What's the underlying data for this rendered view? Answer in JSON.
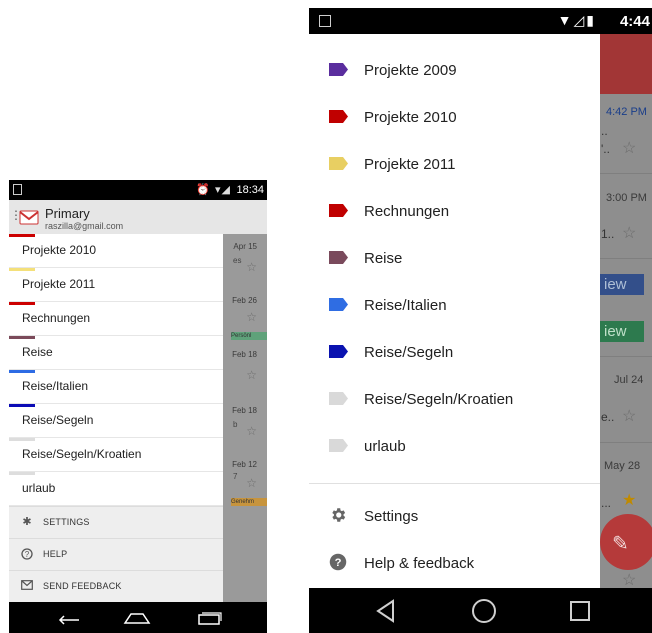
{
  "left_phone": {
    "status_bar": {
      "time": "18:34",
      "icons": "⏰ ▾◢"
    },
    "account": {
      "name": "Primary",
      "email": "raszilla@gmail.com"
    },
    "labels": [
      {
        "name": "Projekte 2010",
        "color": "#cc0000"
      },
      {
        "name": "Projekte 2011",
        "color": "#f4e07a"
      },
      {
        "name": "Rechnungen",
        "color": "#cc0000"
      },
      {
        "name": "Reise",
        "color": "#7b4a5a"
      },
      {
        "name": "Reise/Italien",
        "color": "#2d6be4"
      },
      {
        "name": "Reise/Segeln",
        "color": "#0b0bb5"
      },
      {
        "name": "Reise/Segeln/Kroatien",
        "color": "#dddddd"
      },
      {
        "name": "urlaub",
        "color": "#dddddd"
      }
    ],
    "footer": {
      "settings": "SETTINGS",
      "help": "HELP",
      "send_feedback": "SEND FEEDBACK"
    },
    "background_inbox": {
      "dates": [
        "Apr 15",
        "Feb 26",
        "Feb 18",
        "Feb 18",
        "Feb 12"
      ],
      "fragments": [
        "es",
        "b",
        "7"
      ],
      "tags": [
        "Persönl",
        "Genehm"
      ]
    }
  },
  "right_phone": {
    "status_bar": {
      "time": "4:44"
    },
    "labels": [
      {
        "name": "Projekte 2009",
        "color": "#5a2d9e"
      },
      {
        "name": "Projekte 2010",
        "color": "#c00000"
      },
      {
        "name": "Projekte 2011",
        "color": "#e8cf62"
      },
      {
        "name": "Rechnungen",
        "color": "#c00000"
      },
      {
        "name": "Reise",
        "color": "#7a4a5c"
      },
      {
        "name": "Reise/Italien",
        "color": "#2f6de3"
      },
      {
        "name": "Reise/Segeln",
        "color": "#0a12b0"
      },
      {
        "name": "Reise/Segeln/Kroatien",
        "color": "#d9d9d9"
      },
      {
        "name": "urlaub",
        "color": "#d9d9d9"
      }
    ],
    "footer": {
      "settings": "Settings",
      "help_feedback": "Help & feedback"
    },
    "background_inbox": {
      "dates": [
        "4:42 PM",
        "3:00 PM",
        "Jul 24",
        "May 28"
      ],
      "buttons": [
        "iew",
        "iew"
      ],
      "fragments": [
        "..",
        "'..",
        "1..",
        "e..",
        "..."
      ]
    }
  }
}
